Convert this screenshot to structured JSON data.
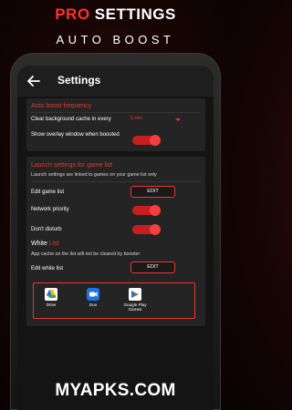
{
  "promo": {
    "headline_pro": "PRO",
    "headline_rest": "SETTINGS",
    "subheadline": "AUTO BOOST"
  },
  "screen": {
    "title": "Settings",
    "back_icon": "arrow-left-icon"
  },
  "auto_boost": {
    "title": "Auto boost frequency",
    "clear_cache_label": "Clear background cache in every",
    "clear_cache_value": "5 min",
    "overlay_label": "Show overlay window when boosted",
    "overlay_on": true
  },
  "launch": {
    "title": "Launch settings for game list",
    "desc": "Launch settings are linked to games on your game list only",
    "edit_game_list_label": "Edit game list",
    "edit_button": "EDIT",
    "network_priority_label": "Network priority",
    "network_priority_on": true,
    "dont_disturb_label": "Don't disturb",
    "dont_disturb_on": true
  },
  "white_list": {
    "title_white": "White ",
    "title_red": "List",
    "desc": "App cache on the list will not be cleared by booster",
    "edit_label": "Edit white list",
    "edit_button": "EDIT",
    "apps": [
      {
        "label": "Drive",
        "icon": "google-drive-icon"
      },
      {
        "label": "Duo",
        "icon": "google-duo-icon"
      },
      {
        "label": "Google Play Games",
        "icon": "google-play-games-icon"
      }
    ]
  },
  "watermark": "MYAPKS.COM",
  "colors": {
    "accent": "#e5382f",
    "toggle_on": "#c81e1e",
    "card_bg": "#242424",
    "screen_bg": "#141414"
  }
}
